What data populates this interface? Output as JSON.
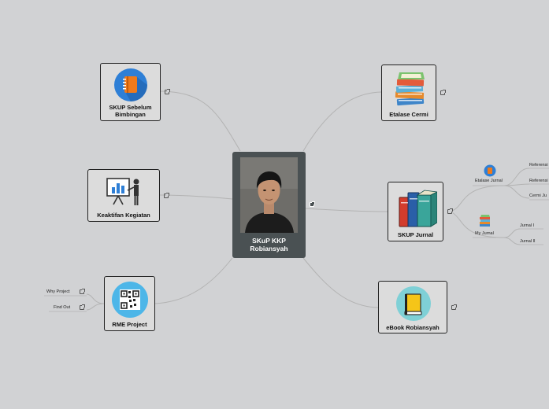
{
  "central": {
    "label": "SKuP KKP Robiansyah"
  },
  "topics": {
    "sebelum": {
      "label": "SKUP Sebelum Bimbingan",
      "icon": "notebook-icon"
    },
    "kegiatan": {
      "label": "Keaktifan Kegiatan",
      "icon": "presentation-icon"
    },
    "rme": {
      "label": "RME Project",
      "icon": "qr-code-icon"
    },
    "etalase": {
      "label": "Etalase Cermi",
      "icon": "book-stack-icon"
    },
    "jurnal": {
      "label": "SKUP Jurnal",
      "icon": "books-icon"
    },
    "ebook": {
      "label": "eBook Robiansyah",
      "icon": "book-icon"
    }
  },
  "subtopics": {
    "why_project": "Why Project",
    "find_out": "Find Out",
    "etalase_jurnal": "Etalase Jurnal",
    "my_jurnal": "My Jurnal",
    "referensi_1": "Referensi",
    "referensi_2": "Referensi",
    "cermi_jurnal": "Cermi Ju",
    "jurnal_1": "Jurnal I",
    "jurnal_2": "Jurnal II"
  },
  "colors": {
    "background": "#d1d2d4",
    "central_fill": "#4a5153",
    "connector": "#b0b0b0"
  }
}
